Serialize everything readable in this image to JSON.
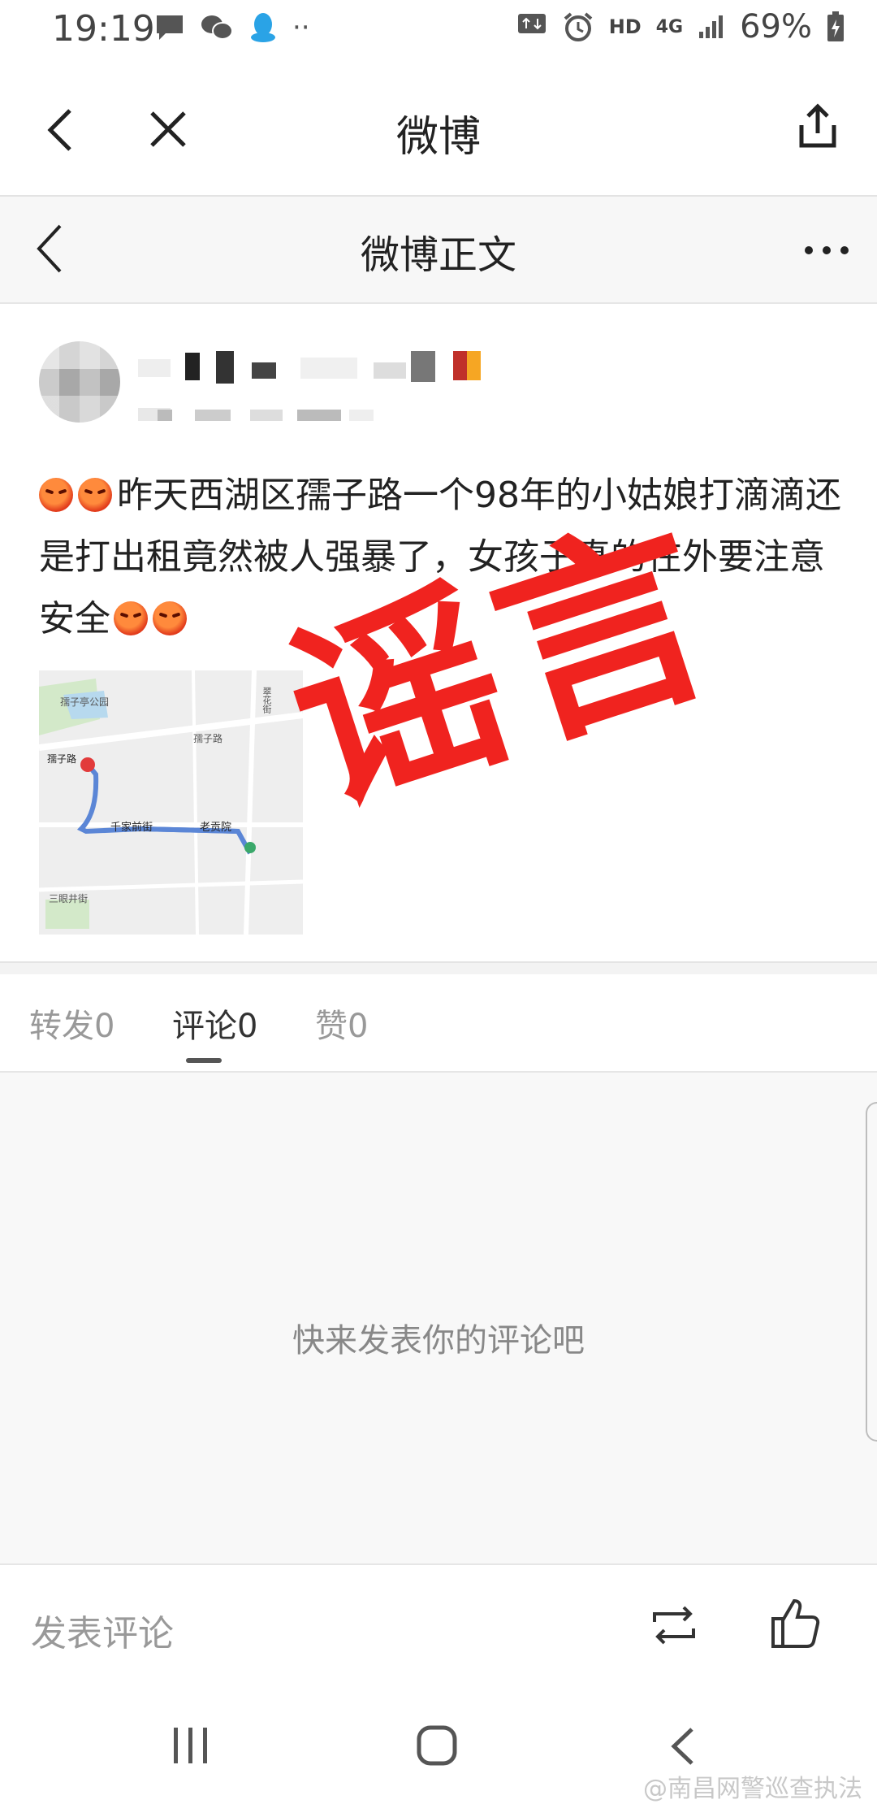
{
  "status_bar": {
    "time": "19:19",
    "network": "HD",
    "signal": "4G",
    "battery": "69%"
  },
  "app_bar": {
    "title": "微博"
  },
  "page_header": {
    "title": "微博正文"
  },
  "post": {
    "text": "昨天西湖区孺子路一个98年的小姑娘打滴滴还是打出租竟然被人强暴了，女孩子真的在外要注意安全",
    "stamp": "谣言",
    "map_labels": {
      "park": "孺子亭公园",
      "road1": "孺子路",
      "road2": "孺子路",
      "street": "千家前街",
      "place": "老贡院",
      "south": "三眼井街",
      "vertical": "翠花街"
    }
  },
  "tabs": [
    {
      "label": "转发0"
    },
    {
      "label": "评论0"
    },
    {
      "label": "赞0"
    }
  ],
  "comments": {
    "empty_text": "快来发表你的评论吧"
  },
  "bottom_bar": {
    "placeholder": "发表评论"
  },
  "watermark": "@南昌网警巡查执法",
  "colors": {
    "stamp": "#f0231f",
    "route": "#5b86d6",
    "pin": "#e23b3b"
  }
}
